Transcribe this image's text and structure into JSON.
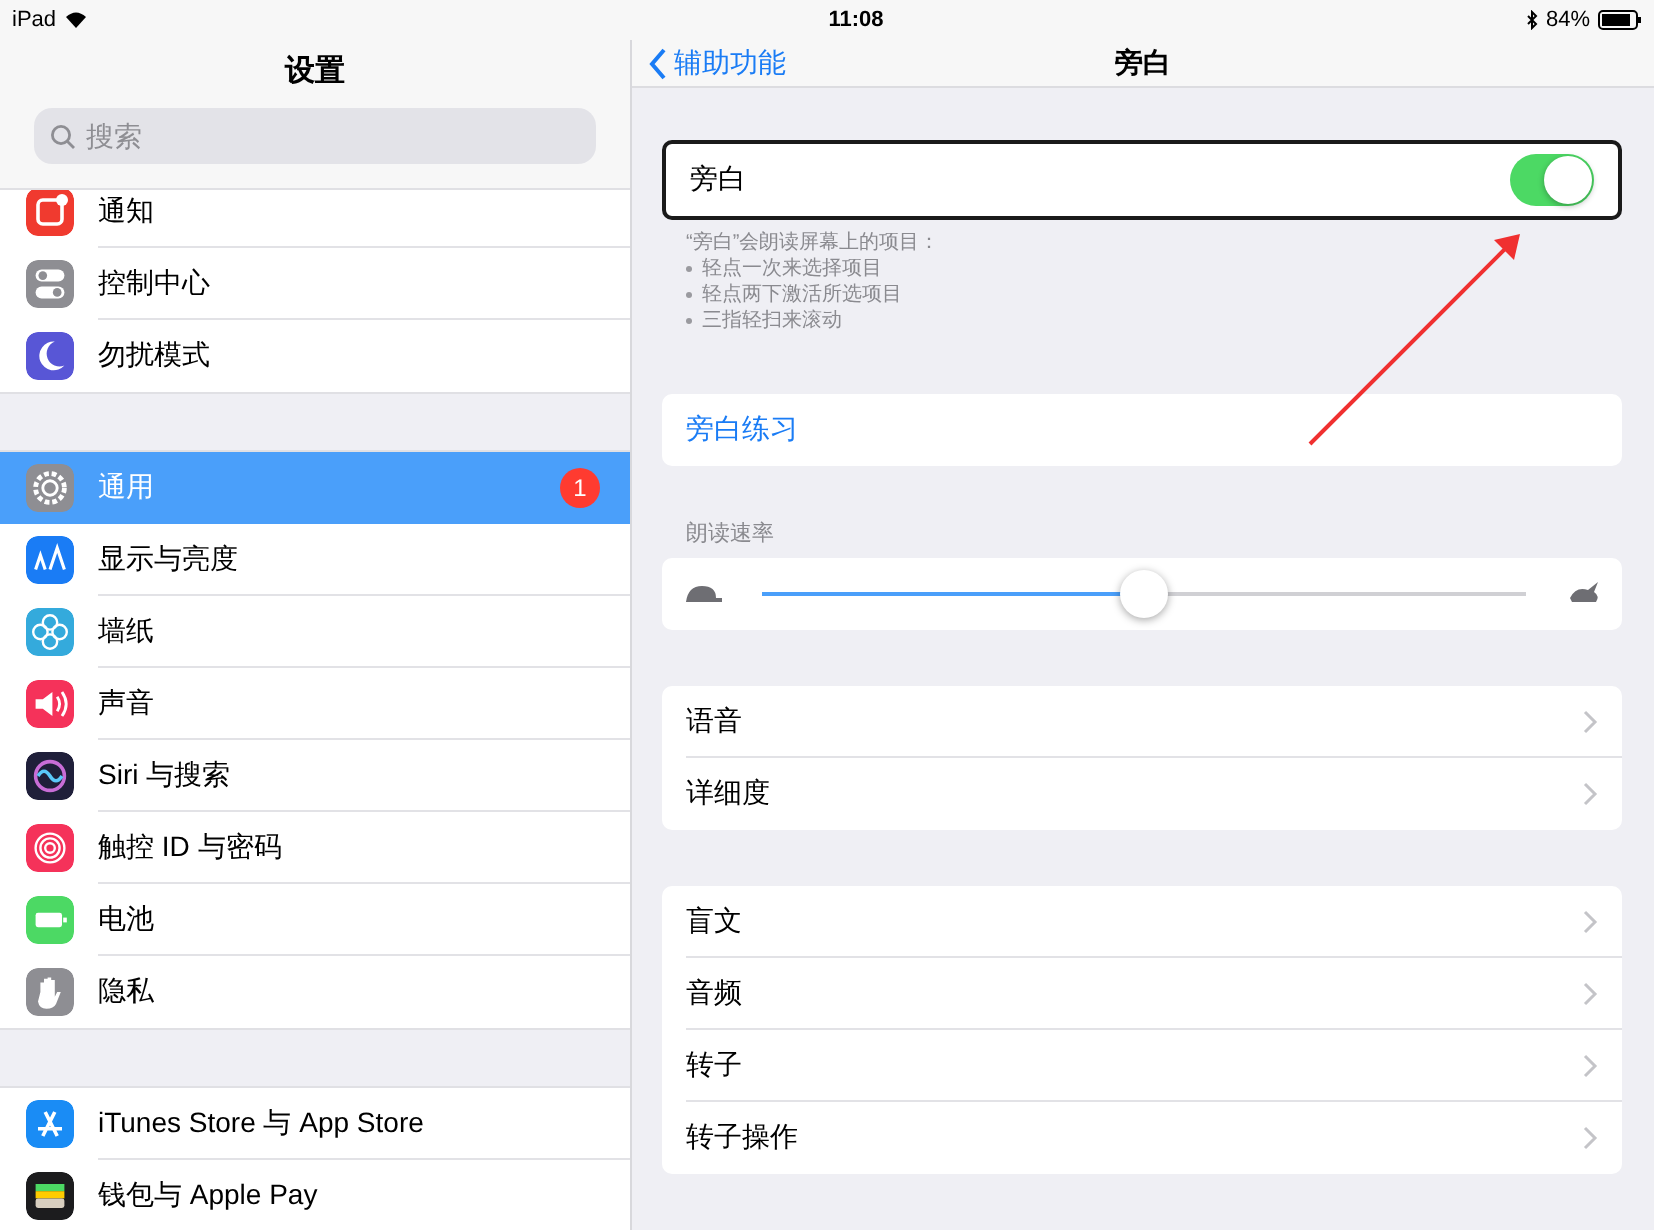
{
  "status_bar": {
    "device": "iPad",
    "time": "11:08",
    "battery": "84%"
  },
  "sidebar": {
    "title": "设置",
    "search": {
      "placeholder": "搜索"
    },
    "groups": [
      {
        "items": [
          {
            "label": "通知",
            "kind": "bell",
            "color": "#f03a2f",
            "selected": false
          },
          {
            "label": "控制中心",
            "kind": "switches",
            "color": "#8e8e93",
            "selected": false
          },
          {
            "label": "勿扰模式",
            "kind": "moon",
            "color": "#5856d6",
            "selected": false
          }
        ]
      },
      {
        "items": [
          {
            "label": "通用",
            "kind": "gear",
            "color": "#8e8e93",
            "selected": true,
            "badge": "1"
          },
          {
            "label": "显示与亮度",
            "kind": "text-size",
            "color": "#1a7cf5",
            "selected": false
          },
          {
            "label": "墙纸",
            "kind": "flower",
            "color": "#34aadc",
            "selected": false
          },
          {
            "label": "声音",
            "kind": "speaker",
            "color": "#f5325a",
            "selected": false
          },
          {
            "label": "Siri 与搜索",
            "kind": "siri",
            "color": "#1f1f3a",
            "selected": false
          },
          {
            "label": "触控 ID 与密码",
            "kind": "fingerprint",
            "color": "#f5325a",
            "selected": false
          },
          {
            "label": "电池",
            "kind": "battery",
            "color": "#4cd964",
            "selected": false
          },
          {
            "label": "隐私",
            "kind": "hand",
            "color": "#8e8e93",
            "selected": false
          }
        ]
      },
      {
        "items": [
          {
            "label": "iTunes Store 与 App Store",
            "kind": "app-store",
            "color": "#1a8cf5",
            "selected": false
          },
          {
            "label": "钱包与 Apple Pay",
            "kind": "wallet",
            "color": "#1c1c1e",
            "selected": false
          }
        ]
      }
    ]
  },
  "detail": {
    "back": "辅助功能",
    "title": "旁白",
    "sections": [
      {
        "kind": "toggle",
        "rows": [
          {
            "label": "旁白",
            "on": true
          }
        ],
        "footer": {
          "text": "“旁白”会朗读屏幕上的项目：",
          "bullets": [
            "轻点一次来选择项目",
            "轻点两下激活所选项目",
            "三指轻扫来滚动"
          ]
        }
      },
      {
        "kind": "link",
        "rows": [
          {
            "label": "旁白练习"
          }
        ]
      },
      {
        "kind": "slider",
        "header": "朗读速率",
        "level": 0.5
      },
      {
        "kind": "nav",
        "rows": [
          {
            "label": "语音"
          },
          {
            "label": "详细度"
          }
        ]
      },
      {
        "kind": "nav",
        "rows": [
          {
            "label": "盲文"
          },
          {
            "label": "音频"
          },
          {
            "label": "转子"
          },
          {
            "label": "转子操作"
          }
        ]
      }
    ]
  }
}
